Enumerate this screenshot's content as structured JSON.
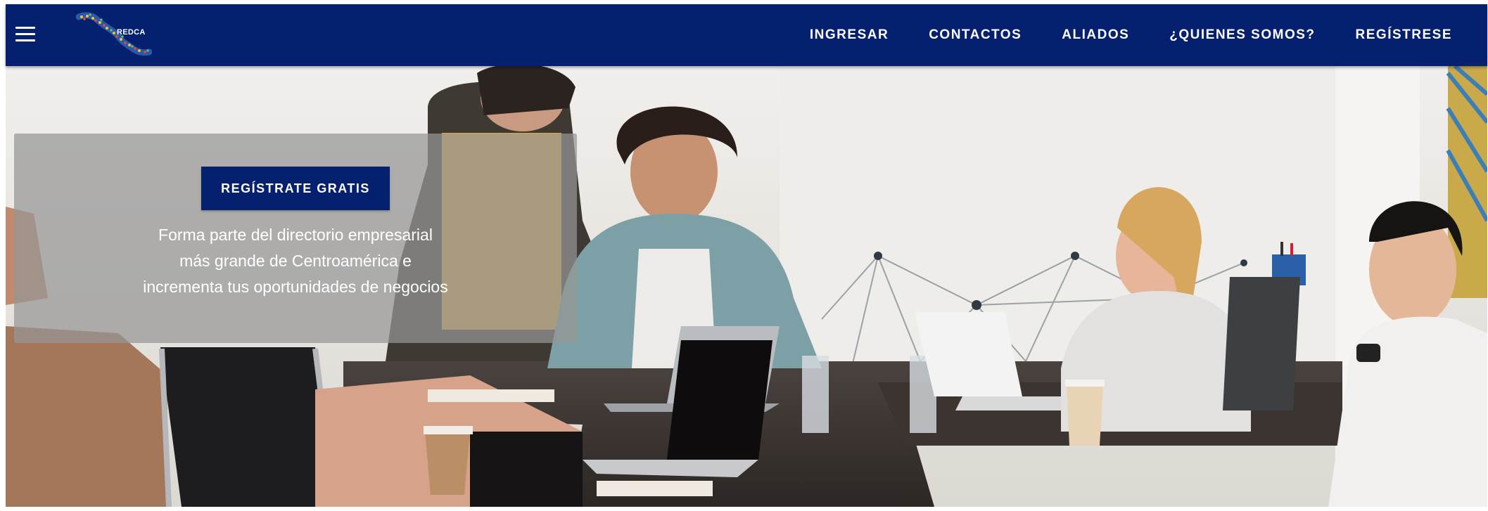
{
  "nav": {
    "logo_text": "REDCA",
    "links": [
      "INGRESAR",
      "CONTACTOS",
      "ALIADOS",
      "¿QUIENES SOMOS?",
      "REGÍSTRESE"
    ]
  },
  "hero": {
    "cta_button": "REGÍSTRATE GRATIS",
    "tagline": [
      "Forma parte del directorio empresarial",
      "más grande de Centroamérica e",
      "incrementa tus oportunidades de negocios"
    ]
  },
  "icons": {
    "menu": "hamburger-menu-icon",
    "logo": "central-america-map-logo"
  },
  "colors": {
    "nav_background": "#04206f",
    "cta_button": "#04206f",
    "cta_panel": "rgba(150,150,150,0.72)"
  }
}
